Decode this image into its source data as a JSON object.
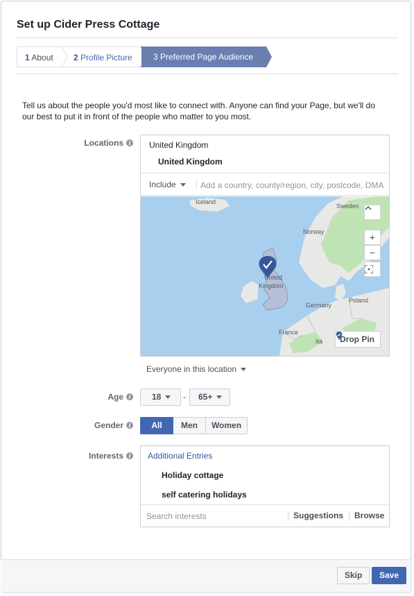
{
  "dialog": {
    "title": "Set up Cider Press Cottage"
  },
  "steps": [
    {
      "num": "1",
      "label": "About"
    },
    {
      "num": "2",
      "label": "Profile Picture"
    },
    {
      "num": "3",
      "label": "Preferred Page Audience"
    }
  ],
  "intro": "Tell us about the people you'd most like to connect with. Anyone can find your Page, but we'll do our best to put it in front of the people who matter to you most.",
  "locations": {
    "label": "Locations",
    "country": "United Kingdom",
    "selected": "United Kingdom",
    "include_label": "Include",
    "placeholder": "Add a country, county/region, city, postcode, DMA",
    "map_labels": {
      "iceland": "Iceland",
      "sweden": "Sweden",
      "norway": "Norway",
      "united": "United",
      "kingdom": "Kingdom",
      "germany": "Germany",
      "poland": "Poland",
      "france": "France",
      "ita": "Ita"
    },
    "zoom_in": "+",
    "zoom_out": "−",
    "drop_pin_label": "Drop Pin",
    "audience_scope": "Everyone in this location"
  },
  "age": {
    "label": "Age",
    "min": "18",
    "dash": "-",
    "max": "65+"
  },
  "gender": {
    "label": "Gender",
    "options": [
      "All",
      "Men",
      "Women"
    ],
    "selected": "All"
  },
  "interests": {
    "label": "Interests",
    "header": "Additional Entries",
    "items": [
      "Holiday cottage",
      "self catering holidays"
    ],
    "placeholder": "Search interests",
    "suggestions_label": "Suggestions",
    "browse_label": "Browse"
  },
  "footer": {
    "skip_label": "Skip",
    "save_label": "Save"
  },
  "colors": {
    "accent": "#4267b2",
    "active_step": "#6a7fb0",
    "sea": "#a9cfee",
    "land": "#e8e9e6",
    "forest": "#bfe3b4",
    "highlight": "#b5c0d8"
  }
}
